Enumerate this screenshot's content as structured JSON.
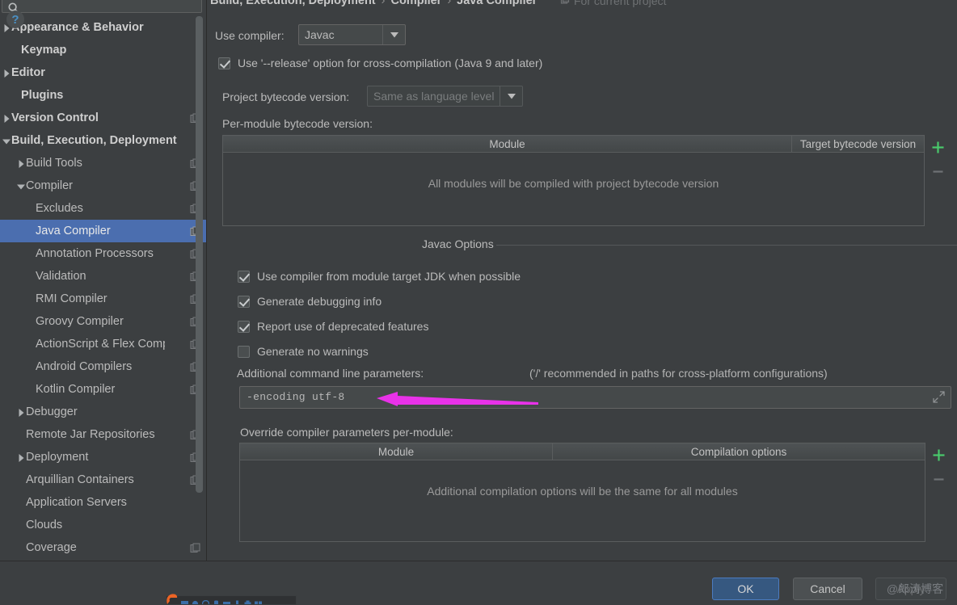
{
  "search": {
    "value": "",
    "placeholder": "",
    "icon": "search-icon"
  },
  "sidebar": {
    "items": [
      {
        "label": "Appearance & Behavior",
        "arrow": "collapsed",
        "bold": true,
        "indent": 14,
        "module_icon": false
      },
      {
        "label": "Keymap",
        "arrow": "none",
        "bold": true,
        "indent": 26,
        "module_icon": false
      },
      {
        "label": "Editor",
        "arrow": "collapsed",
        "bold": true,
        "indent": 14,
        "module_icon": false
      },
      {
        "label": "Plugins",
        "arrow": "none",
        "bold": true,
        "indent": 26,
        "module_icon": false
      },
      {
        "label": "Version Control",
        "arrow": "collapsed",
        "bold": true,
        "indent": 14,
        "module_icon": true
      },
      {
        "label": "Build, Execution, Deployment",
        "arrow": "expanded",
        "bold": true,
        "indent": 14,
        "module_icon": false
      },
      {
        "label": "Build Tools",
        "arrow": "collapsed",
        "bold": false,
        "indent": 32,
        "module_icon": true
      },
      {
        "label": "Compiler",
        "arrow": "expanded",
        "bold": false,
        "indent": 32,
        "module_icon": true
      },
      {
        "label": "Excludes",
        "arrow": "none",
        "bold": false,
        "indent": 44,
        "module_icon": true
      },
      {
        "label": "Java Compiler",
        "arrow": "none",
        "bold": false,
        "indent": 44,
        "module_icon": true,
        "selected": true
      },
      {
        "label": "Annotation Processors",
        "arrow": "none",
        "bold": false,
        "indent": 44,
        "module_icon": true
      },
      {
        "label": "Validation",
        "arrow": "none",
        "bold": false,
        "indent": 44,
        "module_icon": true
      },
      {
        "label": "RMI Compiler",
        "arrow": "none",
        "bold": false,
        "indent": 44,
        "module_icon": true
      },
      {
        "label": "Groovy Compiler",
        "arrow": "none",
        "bold": false,
        "indent": 44,
        "module_icon": true
      },
      {
        "label": "ActionScript & Flex Compiler",
        "arrow": "none",
        "bold": false,
        "indent": 44,
        "module_icon": true,
        "clipped": true
      },
      {
        "label": "Android Compilers",
        "arrow": "none",
        "bold": false,
        "indent": 44,
        "module_icon": true
      },
      {
        "label": "Kotlin Compiler",
        "arrow": "none",
        "bold": false,
        "indent": 44,
        "module_icon": true
      },
      {
        "label": "Debugger",
        "arrow": "collapsed",
        "bold": false,
        "indent": 32,
        "module_icon": false
      },
      {
        "label": "Remote Jar Repositories",
        "arrow": "none",
        "bold": false,
        "indent": 32,
        "module_icon": true
      },
      {
        "label": "Deployment",
        "arrow": "collapsed",
        "bold": false,
        "indent": 32,
        "module_icon": true
      },
      {
        "label": "Arquillian Containers",
        "arrow": "none",
        "bold": false,
        "indent": 32,
        "module_icon": true
      },
      {
        "label": "Application Servers",
        "arrow": "none",
        "bold": false,
        "indent": 32,
        "module_icon": false
      },
      {
        "label": "Clouds",
        "arrow": "none",
        "bold": false,
        "indent": 32,
        "module_icon": false
      },
      {
        "label": "Coverage",
        "arrow": "none",
        "bold": false,
        "indent": 32,
        "module_icon": true
      }
    ]
  },
  "breadcrumb": {
    "crumbs": [
      "Build, Execution, Deployment",
      "Compiler",
      "Java Compiler"
    ],
    "separator": "›",
    "scope_label": "For current project",
    "scope_icon": "module-icon"
  },
  "main": {
    "use_compiler_label": "Use compiler:",
    "use_compiler_value": "Javac",
    "release_option": {
      "label": "Use '--release' option for cross-compilation (Java 9 and later)",
      "checked": true
    },
    "project_bytecode_label": "Project bytecode version:",
    "project_bytecode_value": "Same as language level",
    "per_module_label": "Per-module bytecode version:",
    "bytecode_table": {
      "columns": [
        "Module",
        "Target bytecode version"
      ],
      "rows": [],
      "empty_text": "All modules will be compiled with project bytecode version",
      "add_label": "+",
      "remove_label": "–"
    },
    "javac_group_title": "Javac Options",
    "javac_options": [
      {
        "label": "Use compiler from module target JDK when possible",
        "checked": true
      },
      {
        "label": "Generate debugging info",
        "checked": true
      },
      {
        "label": "Report use of deprecated features",
        "checked": true
      },
      {
        "label": "Generate no warnings",
        "checked": false
      }
    ],
    "additional_params_label": "Additional command line parameters:",
    "additional_params_hint": "('/' recommended in paths for cross-platform configurations)",
    "additional_params_value": "-encoding utf-8",
    "expand_icon": "expand-icon",
    "override_label": "Override compiler parameters per-module:",
    "override_table": {
      "columns": [
        "Module",
        "Compilation options"
      ],
      "rows": [],
      "empty_text": "Additional compilation options will be the same for all modules",
      "add_label": "+",
      "remove_label": "–"
    }
  },
  "annotation": {
    "arrow_color": "#e832e8",
    "direction": "left"
  },
  "footer": {
    "help_label": "?",
    "ok_label": "OK",
    "cancel_label": "Cancel",
    "apply_label": "Apply",
    "watermark": "@郎涛博客"
  },
  "colors": {
    "window_bg": "#3c3f41",
    "selection_blue": "#4b6eaf",
    "ok_button": "#365880",
    "add_green": "#49c96c",
    "text": "#bbbbbb"
  }
}
